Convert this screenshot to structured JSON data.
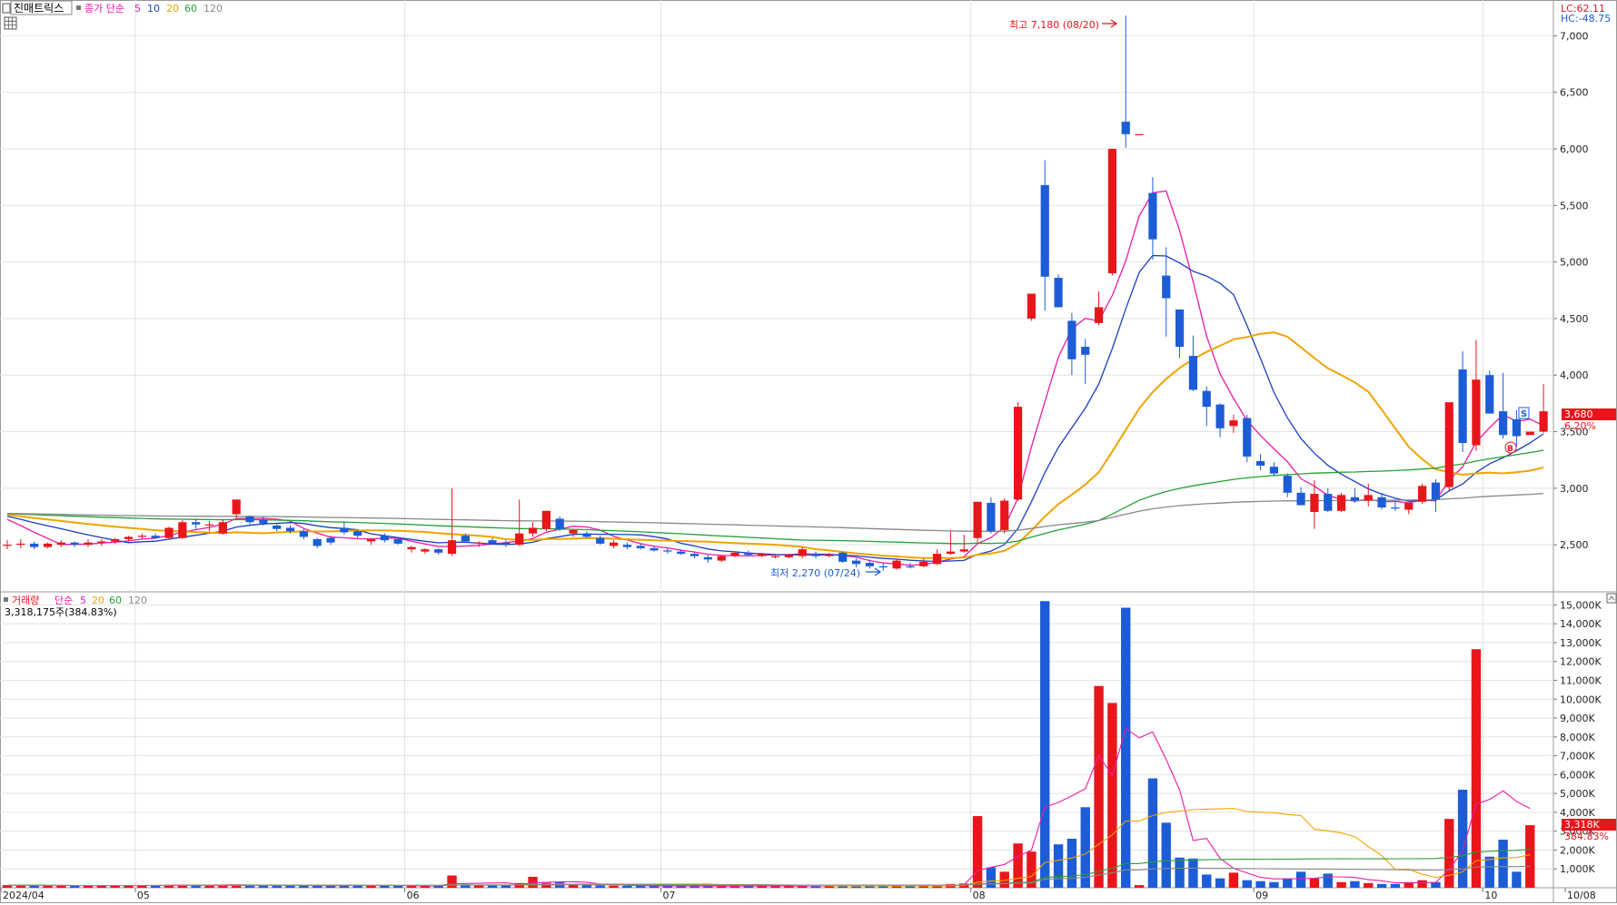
{
  "header": {
    "stock_name": "진매트릭스",
    "price_indicator": "종가 단순",
    "price_ma_periods": [
      "5",
      "10",
      "20",
      "60",
      "120"
    ],
    "lc_label": "LC:62.11",
    "hc_label": "HC:-48.75"
  },
  "volume_header": {
    "label": "거래량",
    "ma_label": "단순",
    "periods": [
      "5",
      "20",
      "60",
      "120"
    ],
    "current": "3,318,175주(384.83%)"
  },
  "annotations": {
    "high": "최고 7,180 (08/20)",
    "low": "최저 2,270 (07/24)",
    "last_price": "3,680",
    "last_change": "6.20%",
    "last_volume": "3,318K",
    "last_volume_pct": "384.83%",
    "sell_marker": "S",
    "buy_marker": "B"
  },
  "colors": {
    "up": "#e8161b",
    "down": "#1c5cd6",
    "ma5": "#ee1aa6",
    "ma10": "#1b3fbf",
    "ma20": "#f0a400",
    "ma60": "#26a035",
    "ma120": "#888888"
  },
  "chart_data": [
    {
      "type": "candlestick",
      "title": "진매트릭스",
      "ylim": [
        2100,
        7300
      ],
      "y_ticks": [
        "2,500",
        "3,000",
        "3,500",
        "4,000",
        "4,500",
        "5,000",
        "5,500",
        "6,000",
        "6,500",
        "7,000"
      ],
      "y_tick_values": [
        2500,
        3000,
        3500,
        4000,
        4500,
        5000,
        5500,
        6000,
        6500,
        7000
      ],
      "x_labels": [
        "2024/04",
        "05",
        "06",
        "07",
        "08",
        "09",
        "10",
        "10/08"
      ],
      "x_label_index": [
        0,
        10,
        30,
        49,
        72,
        93,
        110,
        117
      ],
      "candles": [
        [
          2500,
          2540,
          2460,
          2500
        ],
        [
          2500,
          2550,
          2470,
          2510
        ],
        [
          2510,
          2530,
          2460,
          2480
        ],
        [
          2480,
          2520,
          2470,
          2510
        ],
        [
          2500,
          2540,
          2480,
          2520
        ],
        [
          2520,
          2530,
          2480,
          2500
        ],
        [
          2500,
          2550,
          2480,
          2520
        ],
        [
          2520,
          2550,
          2490,
          2530
        ],
        [
          2530,
          2560,
          2510,
          2550
        ],
        [
          2550,
          2580,
          2530,
          2570
        ],
        [
          2570,
          2600,
          2550,
          2580
        ],
        [
          2580,
          2600,
          2550,
          2560
        ],
        [
          2560,
          2660,
          2550,
          2650
        ],
        [
          2560,
          2720,
          2550,
          2700
        ],
        [
          2700,
          2730,
          2640,
          2680
        ],
        [
          2680,
          2710,
          2620,
          2680
        ],
        [
          2600,
          2720,
          2590,
          2700
        ],
        [
          2770,
          2860,
          2740,
          2900
        ],
        [
          2750,
          2760,
          2680,
          2700
        ],
        [
          2720,
          2750,
          2670,
          2690
        ],
        [
          2670,
          2690,
          2620,
          2640
        ],
        [
          2650,
          2670,
          2600,
          2620
        ],
        [
          2620,
          2640,
          2550,
          2570
        ],
        [
          2550,
          2560,
          2470,
          2490
        ],
        [
          2560,
          2580,
          2500,
          2520
        ],
        [
          2650,
          2700,
          2590,
          2610
        ],
        [
          2620,
          2630,
          2560,
          2580
        ],
        [
          2530,
          2560,
          2500,
          2550
        ],
        [
          2580,
          2600,
          2520,
          2540
        ],
        [
          2550,
          2560,
          2500,
          2510
        ],
        [
          2460,
          2490,
          2430,
          2480
        ],
        [
          2440,
          2470,
          2420,
          2460
        ],
        [
          2460,
          2470,
          2410,
          2430
        ],
        [
          2420,
          3000,
          2400,
          2540
        ],
        [
          2580,
          2600,
          2520,
          2530
        ],
        [
          2510,
          2530,
          2480,
          2520
        ],
        [
          2540,
          2560,
          2500,
          2510
        ],
        [
          2520,
          2540,
          2480,
          2500
        ],
        [
          2500,
          2900,
          2490,
          2600
        ],
        [
          2600,
          2700,
          2570,
          2650
        ],
        [
          2640,
          2800,
          2620,
          2800
        ],
        [
          2730,
          2750,
          2620,
          2640
        ],
        [
          2600,
          2640,
          2570,
          2630
        ],
        [
          2600,
          2620,
          2560,
          2570
        ],
        [
          2560,
          2580,
          2500,
          2510
        ],
        [
          2490,
          2540,
          2470,
          2520
        ],
        [
          2500,
          2520,
          2460,
          2480
        ],
        [
          2490,
          2510,
          2460,
          2470
        ],
        [
          2470,
          2490,
          2440,
          2450
        ],
        [
          2450,
          2470,
          2420,
          2440
        ],
        [
          2440,
          2460,
          2410,
          2420
        ],
        [
          2420,
          2440,
          2380,
          2400
        ],
        [
          2390,
          2410,
          2340,
          2370
        ],
        [
          2360,
          2410,
          2350,
          2400
        ],
        [
          2400,
          2440,
          2390,
          2430
        ],
        [
          2430,
          2450,
          2400,
          2410
        ],
        [
          2400,
          2430,
          2390,
          2420
        ],
        [
          2390,
          2420,
          2380,
          2400
        ],
        [
          2390,
          2420,
          2380,
          2410
        ],
        [
          2400,
          2480,
          2380,
          2460
        ],
        [
          2420,
          2440,
          2380,
          2400
        ],
        [
          2400,
          2430,
          2390,
          2410
        ],
        [
          2430,
          2440,
          2340,
          2350
        ],
        [
          2360,
          2380,
          2300,
          2330
        ],
        [
          2340,
          2370,
          2290,
          2310
        ],
        [
          2310,
          2340,
          2270,
          2300
        ],
        [
          2290,
          2370,
          2280,
          2360
        ],
        [
          2310,
          2340,
          2290,
          2300
        ],
        [
          2310,
          2380,
          2300,
          2350
        ],
        [
          2330,
          2460,
          2320,
          2420
        ],
        [
          2420,
          2620,
          2410,
          2440
        ],
        [
          2440,
          2590,
          2430,
          2460
        ],
        [
          2560,
          2870,
          2520,
          2880
        ],
        [
          2870,
          2920,
          2600,
          2620
        ],
        [
          2630,
          2910,
          2600,
          2890
        ],
        [
          2900,
          3760,
          2890,
          3720
        ],
        [
          4500,
          4530,
          4480,
          4720
        ],
        [
          5680,
          5900,
          4570,
          4870
        ],
        [
          4860,
          4890,
          4620,
          4600
        ],
        [
          4480,
          4550,
          4000,
          4140
        ],
        [
          4250,
          4320,
          3920,
          4180
        ],
        [
          4460,
          4740,
          4440,
          4600
        ],
        [
          4900,
          5320,
          4880,
          6000
        ],
        [
          6240,
          7180,
          6010,
          6130
        ],
        [
          6130,
          6130,
          6130,
          6130
        ],
        [
          5610,
          5750,
          5020,
          5200
        ],
        [
          4880,
          5130,
          4340,
          4680
        ],
        [
          4580,
          4570,
          4150,
          4250
        ],
        [
          4170,
          4350,
          3860,
          3870
        ],
        [
          3860,
          3900,
          3550,
          3720
        ],
        [
          3740,
          3750,
          3450,
          3530
        ],
        [
          3550,
          3650,
          3490,
          3600
        ],
        [
          3620,
          3650,
          3230,
          3280
        ],
        [
          3240,
          3300,
          3160,
          3200
        ],
        [
          3190,
          3230,
          3110,
          3130
        ],
        [
          3110,
          3130,
          2920,
          2960
        ],
        [
          2960,
          3010,
          2850,
          2850
        ],
        [
          2790,
          3070,
          2640,
          2950
        ],
        [
          2950,
          3000,
          2790,
          2800
        ],
        [
          2800,
          2960,
          2790,
          2940
        ],
        [
          2920,
          3000,
          2870,
          2890
        ],
        [
          2890,
          3040,
          2840,
          2940
        ],
        [
          2920,
          2960,
          2810,
          2830
        ],
        [
          2830,
          2890,
          2800,
          2820
        ],
        [
          2810,
          2870,
          2770,
          2870
        ],
        [
          2880,
          3040,
          2860,
          3020
        ],
        [
          3050,
          3080,
          2790,
          2900
        ],
        [
          3010,
          3740,
          2980,
          3760
        ],
        [
          4050,
          4210,
          3320,
          3400
        ],
        [
          3380,
          4310,
          3330,
          3960
        ],
        [
          4000,
          4040,
          3670,
          3660
        ],
        [
          3680,
          4020,
          3440,
          3470
        ],
        [
          3610,
          3690,
          3370,
          3460
        ],
        [
          3470,
          3500,
          3500,
          3500
        ],
        [
          3500,
          3920,
          3490,
          3680
        ]
      ]
    },
    {
      "type": "bar",
      "title": "거래량",
      "ylabel": "",
      "ylim": [
        0,
        15500
      ],
      "y_ticks": [
        "1,000K",
        "2,000K",
        "3,000K",
        "4,000K",
        "5,000K",
        "6,000K",
        "7,000K",
        "8,000K",
        "9,000K",
        "10,000K",
        "11,000K",
        "12,000K",
        "13,000K",
        "14,000K",
        "15,000K"
      ],
      "y_tick_values": [
        1000,
        2000,
        3000,
        4000,
        5000,
        6000,
        7000,
        8000,
        9000,
        10000,
        11000,
        12000,
        13000,
        14000,
        15000
      ],
      "unit": "K",
      "values": [
        140,
        130,
        120,
        110,
        120,
        110,
        120,
        110,
        120,
        130,
        140,
        120,
        150,
        160,
        140,
        140,
        150,
        170,
        140,
        120,
        110,
        110,
        120,
        100,
        120,
        130,
        120,
        110,
        120,
        110,
        100,
        100,
        100,
        650,
        180,
        150,
        170,
        150,
        250,
        580,
        260,
        320,
        170,
        140,
        120,
        110,
        100,
        100,
        100,
        100,
        90,
        90,
        90,
        90,
        100,
        100,
        100,
        100,
        100,
        110,
        100,
        100,
        110,
        100,
        100,
        100,
        110,
        100,
        110,
        140,
        200,
        220,
        3800,
        1080,
        850,
        2350,
        1920,
        15200,
        2300,
        2600,
        4270,
        10700,
        9800,
        14850,
        140,
        5800,
        3450,
        1600,
        1550,
        700,
        500,
        800,
        400,
        350,
        300,
        500,
        850,
        500,
        750,
        300,
        350,
        250,
        200,
        200,
        300,
        400,
        300,
        3650,
        5200,
        12650,
        1650,
        2550,
        850,
        3318
      ]
    }
  ]
}
